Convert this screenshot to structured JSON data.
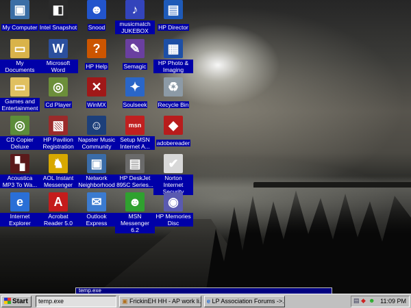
{
  "desktop_icons": [
    {
      "label": "My Computer",
      "icon": "my-computer-icon",
      "color": "#3b6ea5",
      "glyph": "▣"
    },
    {
      "label": "Intel Snapshot",
      "icon": "intel-snapshot-icon",
      "color": "#2a2a2a",
      "glyph": "◧"
    },
    {
      "label": "Snood",
      "icon": "snood-icon",
      "color": "#2255cc",
      "glyph": "☻"
    },
    {
      "label": "musicmatch JUKEBOX",
      "icon": "musicmatch-icon",
      "color": "#3344bb",
      "glyph": "♪"
    },
    {
      "label": "HP Director",
      "icon": "hp-director-icon",
      "color": "#1e5ab8",
      "glyph": "▤"
    },
    {
      "label": "My Documents",
      "icon": "my-documents-icon",
      "color": "#d9b34a",
      "glyph": "▭"
    },
    {
      "label": "Microsoft Word",
      "icon": "microsoft-word-icon",
      "color": "#2b4f9e",
      "glyph": "W"
    },
    {
      "label": "HP Help",
      "icon": "hp-help-icon",
      "color": "#cc5500",
      "glyph": "?"
    },
    {
      "label": "Semagic",
      "icon": "semagic-icon",
      "color": "#6a3fa0",
      "glyph": "✎"
    },
    {
      "label": "HP Photo & Imaging",
      "icon": "hp-photo-imaging-icon",
      "color": "#1d4fa6",
      "glyph": "▦"
    },
    {
      "label": "Games and Entertainment",
      "icon": "games-folder-icon",
      "color": "#e0c060",
      "glyph": "▭"
    },
    {
      "label": "Cd Player",
      "icon": "cd-player-icon",
      "color": "#6c8f3a",
      "glyph": "◎"
    },
    {
      "label": "WinMX",
      "icon": "winmx-icon",
      "color": "#a01818",
      "glyph": "✕"
    },
    {
      "label": "Soulseek",
      "icon": "soulseek-icon",
      "color": "#2a66c8",
      "glyph": "✦"
    },
    {
      "label": "Recycle Bin",
      "icon": "recycle-bin-icon",
      "color": "#8c9aa6",
      "glyph": "♻"
    },
    {
      "label": "CD Copier Deluxe",
      "icon": "cd-copier-icon",
      "color": "#5c8c3a",
      "glyph": "◎"
    },
    {
      "label": "HP Pavilion Registration",
      "icon": "hp-pavilion-icon",
      "color": "#9a2b2b",
      "glyph": "▧"
    },
    {
      "label": "Napster Music Community",
      "icon": "napster-icon",
      "color": "#1c3f7a",
      "glyph": "☺"
    },
    {
      "label": "Setup MSN Internet A...",
      "icon": "msn-setup-icon",
      "color": "#c02020",
      "glyph": "msn"
    },
    {
      "label": "adobereader",
      "icon": "adobe-reader-icon",
      "color": "#b81c1c",
      "glyph": "◆"
    },
    {
      "label": "Acoustica MP3 To Wa...",
      "icon": "acoustica-icon",
      "color": "#5a1a1a",
      "glyph": "▚"
    },
    {
      "label": "AOL Instant Messenger",
      "icon": "aol-messenger-icon",
      "color": "#d8a800",
      "glyph": "♞"
    },
    {
      "label": "Network Neighborhood",
      "icon": "network-neighborhood-icon",
      "color": "#3a6ca8",
      "glyph": "▣"
    },
    {
      "label": "HP DeskJet 895C Series...",
      "icon": "printer-icon",
      "color": "#6a6a6a",
      "glyph": "▤"
    },
    {
      "label": "Norton Internet Security",
      "icon": "norton-icon",
      "color": "#d8d8d8",
      "glyph": "✔"
    },
    {
      "label": "Internet Explorer",
      "icon": "internet-explorer-icon",
      "color": "#2a6fd6",
      "glyph": "e"
    },
    {
      "label": "Acrobat Reader 5.0",
      "icon": "acrobat-reader-icon",
      "color": "#c41c1c",
      "glyph": "A"
    },
    {
      "label": "Outlook Express",
      "icon": "outlook-express-icon",
      "color": "#3b7bd0",
      "glyph": "✉"
    },
    {
      "label": "MSN Messenger 6.2",
      "icon": "msn-messenger-icon",
      "color": "#2fa12f",
      "glyph": "☻"
    },
    {
      "label": "HP Memories Disc",
      "icon": "hp-memories-icon",
      "color": "#5a5ab0",
      "glyph": "◉"
    }
  ],
  "popup": {
    "title": "temp.exe"
  },
  "taskbar": {
    "start_label": "Start",
    "buttons": [
      {
        "label": "temp.exe",
        "icon": "",
        "pressed": true
      },
      {
        "label": "FrickinEH   HH - AP work li...",
        "icon": "browser-window-icon",
        "pressed": false
      },
      {
        "label": "LP Association Forums ->...",
        "icon": "internet-explorer-icon",
        "pressed": false
      }
    ],
    "clock": "11:09 PM"
  }
}
